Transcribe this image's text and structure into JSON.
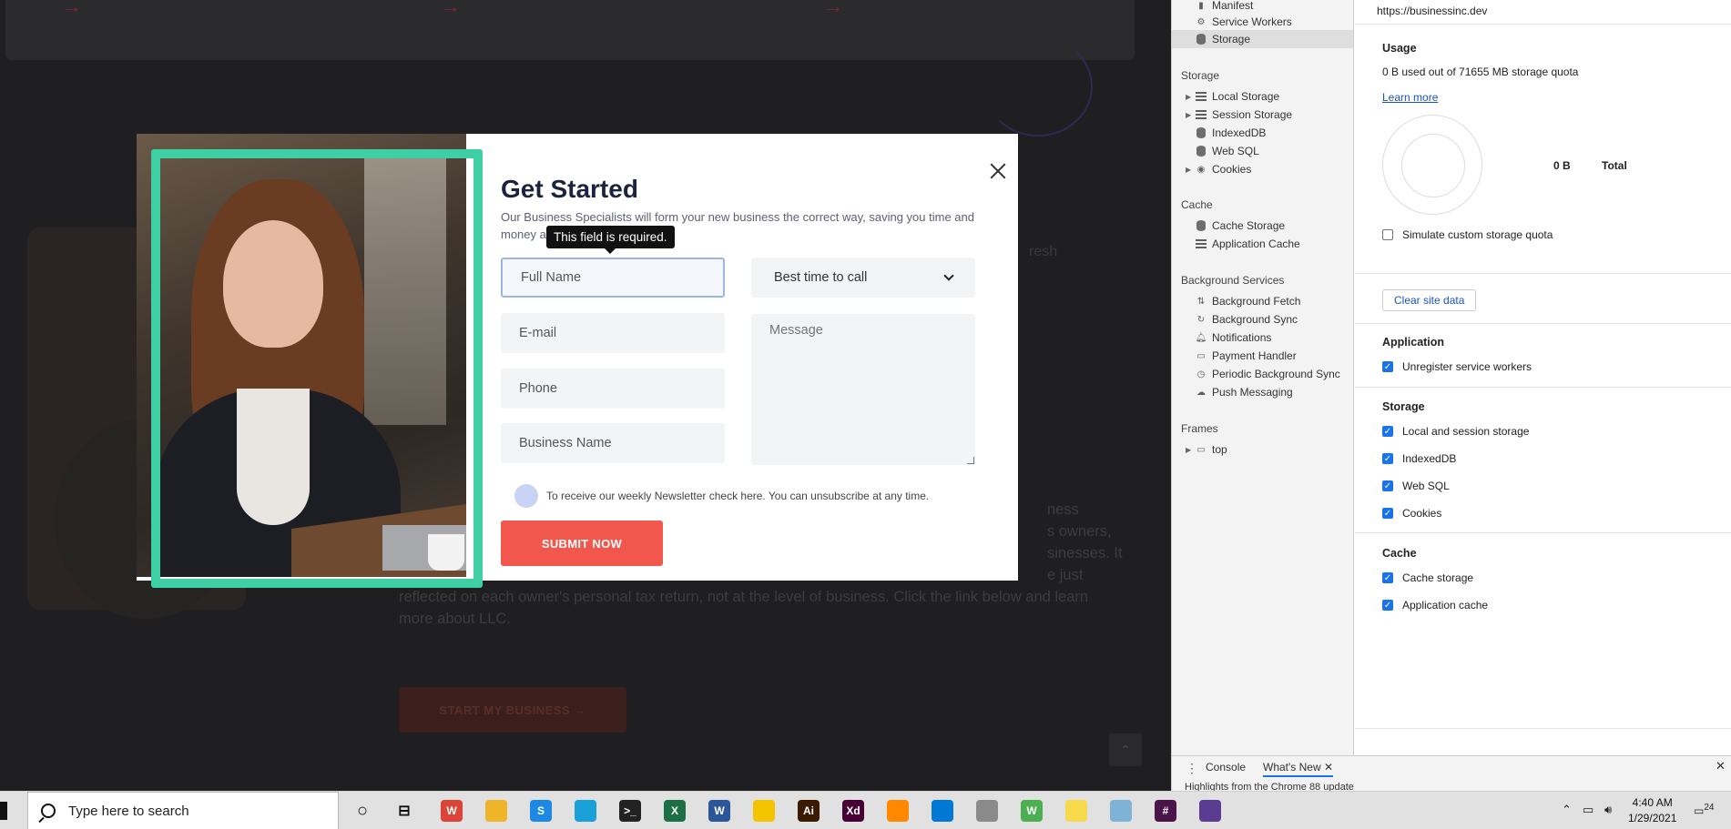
{
  "website": {
    "background_paragraph": "reflected on each owner's personal tax return, not at the level of business. Click the link below and learn more about LLC.",
    "right_fragments": [
      "ness",
      "s owners,",
      "sinesses. It",
      "e just"
    ],
    "fresh_fragment": "resh",
    "cta_label": "START MY BUSINESS →"
  },
  "modal": {
    "title": "Get Started",
    "description": "Our Business Specialists will form your new business the correct way, saving you time and money and avoiding errors.",
    "tooltip": "This field is required.",
    "fields": {
      "full_name_placeholder": "Full Name",
      "email_placeholder": "E-mail",
      "phone_placeholder": "Phone",
      "business_name_placeholder": "Business Name",
      "best_time_selected": "Best time to call",
      "message_placeholder": "Message"
    },
    "newsletter_text": "To receive our weekly Newsletter check here. You can unsubscribe at any time.",
    "submit_label": "SUBMIT NOW"
  },
  "devtools": {
    "sidebar": {
      "app_items": [
        "Manifest",
        "Service Workers",
        "Storage"
      ],
      "storage_heading": "Storage",
      "storage_items": [
        "Local Storage",
        "Session Storage",
        "IndexedDB",
        "Web SQL",
        "Cookies"
      ],
      "cache_heading": "Cache",
      "cache_items": [
        "Cache Storage",
        "Application Cache"
      ],
      "bg_heading": "Background Services",
      "bg_items": [
        "Background Fetch",
        "Background Sync",
        "Notifications",
        "Payment Handler",
        "Periodic Background Sync",
        "Push Messaging"
      ],
      "frames_heading": "Frames",
      "frames_items": [
        "top"
      ]
    },
    "main": {
      "url": "https://businessinc.dev",
      "usage_heading": "Usage",
      "usage_text": "0 B used out of 71655 MB storage quota",
      "learn_more": "Learn more",
      "total_value": "0 B",
      "total_label": "Total",
      "simulate_label": "Simulate custom storage quota",
      "clear_button": "Clear site data",
      "application_heading": "Application",
      "unregister_label": "Unregister service workers",
      "storage_heading": "Storage",
      "storage_checks": [
        "Local and session storage",
        "IndexedDB",
        "Web SQL",
        "Cookies"
      ],
      "cache_heading": "Cache",
      "cache_checks": [
        "Cache storage",
        "Application cache"
      ]
    },
    "drawer": {
      "tab_console": "Console",
      "tab_whats_new": "What's New",
      "preview_text": "Highlights from the Chrome 88 update"
    }
  },
  "taskbar": {
    "search_placeholder": "Type here to search",
    "time": "4:40 AM",
    "date": "1/29/2021",
    "notification_count": "24",
    "app_icons": [
      {
        "name": "chrome-w-icon",
        "label": "W",
        "color": "#db4437"
      },
      {
        "name": "file-explorer-icon",
        "label": "",
        "color": "#f0b429"
      },
      {
        "name": "skype-s-icon",
        "label": "S",
        "color": "#1e88e5"
      },
      {
        "name": "edge-icon",
        "label": "",
        "color": "#1aa0d8"
      },
      {
        "name": "terminal-icon",
        "label": ">_",
        "color": "#222222"
      },
      {
        "name": "excel-icon",
        "label": "X",
        "color": "#1d7044"
      },
      {
        "name": "word-icon",
        "label": "W",
        "color": "#2b579a"
      },
      {
        "name": "norton-icon",
        "label": "",
        "color": "#f5c400"
      },
      {
        "name": "illustrator-icon",
        "label": "Ai",
        "color": "#3a1a00"
      },
      {
        "name": "adobe-xd-icon",
        "label": "Xd",
        "color": "#470137"
      },
      {
        "name": "vlc-icon",
        "label": "",
        "color": "#ff8800"
      },
      {
        "name": "vscode-icon",
        "label": "",
        "color": "#0078d4"
      },
      {
        "name": "snipping-icon",
        "label": "",
        "color": "#8a8a8a"
      },
      {
        "name": "chrome-profile-icon",
        "label": "W",
        "color": "#4caf50"
      },
      {
        "name": "sticky-notes-icon",
        "label": "",
        "color": "#f7d94c"
      },
      {
        "name": "shell-app-icon",
        "label": "",
        "color": "#7fb3d5"
      },
      {
        "name": "slack-icon",
        "label": "#",
        "color": "#4a154b"
      },
      {
        "name": "obs-icon",
        "label": "",
        "color": "#5c3c92"
      }
    ]
  },
  "colors": {
    "accent_green": "#3ecfa5",
    "submit_red": "#f2574d",
    "devtools_blue": "#1a73e8"
  }
}
